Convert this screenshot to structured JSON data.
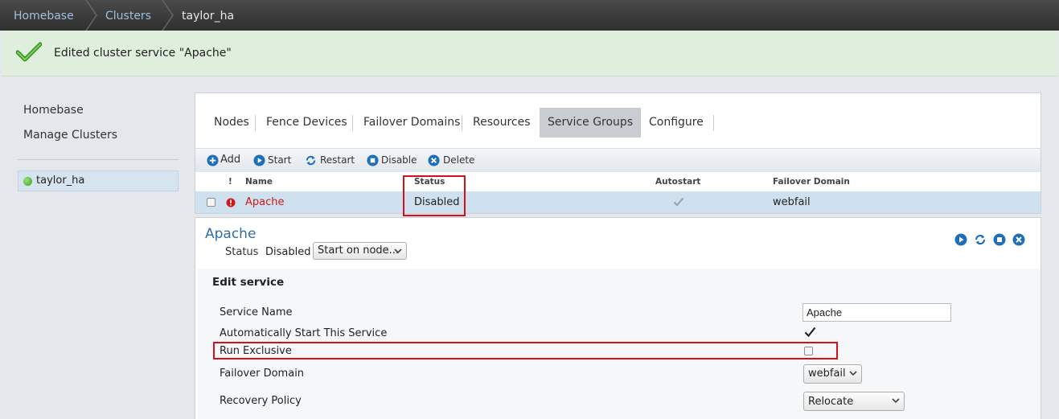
{
  "breadcrumb": {
    "items": [
      "Homebase",
      "Clusters",
      "taylor_ha"
    ]
  },
  "banner": {
    "message": "Edited cluster service \"Apache\"",
    "icon": "checkmark-icon"
  },
  "sidebar": {
    "links": [
      "Homebase",
      "Manage Clusters"
    ],
    "cluster": {
      "label": "taylor_ha",
      "status_color": "#3aa01c"
    }
  },
  "tabs": {
    "items": [
      "Nodes",
      "Fence Devices",
      "Failover Domains",
      "Resources",
      "Service Groups",
      "Configure"
    ],
    "active": "Service Groups"
  },
  "toolbar": {
    "add": "Add",
    "start": "Start",
    "restart": "Restart",
    "disable": "Disable",
    "delete": "Delete"
  },
  "table": {
    "columns": [
      "!",
      "Name",
      "Status",
      "Autostart",
      "Failover Domain"
    ],
    "rows": [
      {
        "name": "Apache",
        "status": "Disabled",
        "autostart": true,
        "failover_domain": "webfail"
      }
    ]
  },
  "detail": {
    "title": "Apache",
    "status_label": "Status",
    "status_value": "Disabled",
    "start_select": "Start on node..."
  },
  "edit": {
    "heading": "Edit service",
    "service_name_label": "Service Name",
    "service_name_value": "Apache",
    "autostart_label": "Automatically Start This Service",
    "autostart_checked": true,
    "run_exclusive_label": "Run Exclusive",
    "run_exclusive_checked": false,
    "failover_domain_label": "Failover Domain",
    "failover_domain_value": "webfail",
    "recovery_policy_label": "Recovery Policy",
    "recovery_policy_value": "Relocate"
  },
  "colors": {
    "highlight_red": "#d6101a",
    "link_blue": "#2f6ea6",
    "error_red": "#d01818"
  }
}
